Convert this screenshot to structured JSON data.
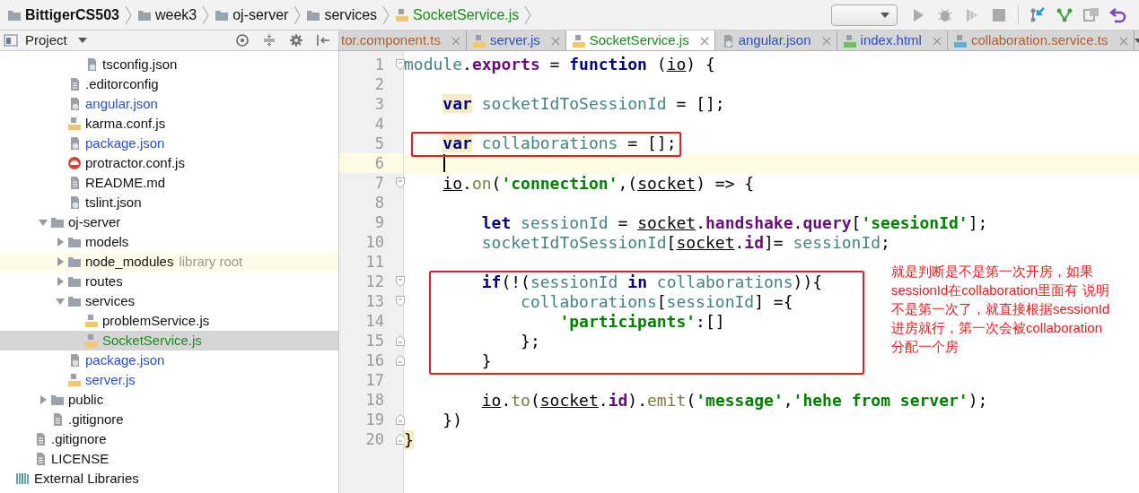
{
  "breadcrumb": [
    {
      "label": "BittigerCS503",
      "kind": "folder",
      "bold": true
    },
    {
      "label": "week3",
      "kind": "folder"
    },
    {
      "label": "oj-server",
      "kind": "folder"
    },
    {
      "label": "services",
      "kind": "folder"
    },
    {
      "label": "SocketService.js",
      "kind": "js",
      "color": "#1d8a1d"
    }
  ],
  "toolbar": {
    "buttons": [
      {
        "kind": "dropdown"
      },
      {
        "kind": "run"
      },
      {
        "kind": "debug"
      },
      {
        "kind": "coverage"
      },
      {
        "kind": "stop"
      },
      {
        "kind": "vcs-update"
      },
      {
        "kind": "vcs-commit"
      },
      {
        "kind": "compare"
      },
      {
        "kind": "revert"
      }
    ]
  },
  "project_panel": {
    "title": "Project",
    "tree": [
      {
        "children": [
          {
            "children": [
              {
                "children": [
                  {
                    "children": [
                      {
                        "label": "tsconfig.json",
                        "kind": "json"
                      }
                    ]
                  },
                  {
                    "label": ".editorconfig",
                    "kind": "text"
                  },
                  {
                    "label": "angular.json",
                    "kind": "json",
                    "color": "#2d4fbd"
                  },
                  {
                    "label": "karma.conf.js",
                    "kind": "js"
                  },
                  {
                    "label": "package.json",
                    "kind": "json",
                    "color": "#2d4fbd"
                  },
                  {
                    "label": "protractor.conf.js",
                    "kind": "protractor"
                  },
                  {
                    "label": "README.md",
                    "kind": "text"
                  },
                  {
                    "label": "tslint.json",
                    "kind": "json"
                  }
                ]
              },
              {
                "label": "oj-server",
                "kind": "folder",
                "expanded": true,
                "children": [
                  {
                    "label": "models",
                    "kind": "folder",
                    "expanded": false
                  },
                  {
                    "label": "node_modules",
                    "kind": "folder",
                    "expanded": false,
                    "library_root": true,
                    "note": "library root"
                  },
                  {
                    "label": "routes",
                    "kind": "folder",
                    "expanded": false
                  },
                  {
                    "label": "services",
                    "kind": "folder",
                    "expanded": true,
                    "children": [
                      {
                        "label": "problemService.js",
                        "kind": "js",
                        "selected": false
                      },
                      {
                        "label": "SocketService.js",
                        "kind": "js",
                        "color": "#1d8a1d",
                        "selected": true
                      }
                    ]
                  },
                  {
                    "label": "package.json",
                    "kind": "json",
                    "color": "#2d4fbd"
                  },
                  {
                    "label": "server.js",
                    "kind": "js",
                    "color": "#2d4fbd"
                  }
                ]
              },
              {
                "label": "public",
                "kind": "folder",
                "expanded": false
              },
              {
                "label": ".gitignore",
                "kind": "text"
              }
            ]
          },
          {
            "label": ".gitignore",
            "kind": "text"
          },
          {
            "label": "LICENSE",
            "kind": "text"
          }
        ]
      },
      {
        "label": "External Libraries",
        "kind": "libraries"
      }
    ]
  },
  "editor": {
    "tabs": [
      {
        "label": "tor.component.ts",
        "color": "#b0602e",
        "selected": false
      },
      {
        "label": "server.js",
        "kind": "js",
        "color": "#2d4fbd",
        "selected": false
      },
      {
        "label": "SocketService.js",
        "kind": "js",
        "color": "#1d8a1d",
        "selected": true
      },
      {
        "label": "angular.json",
        "kind": "json",
        "color": "#2d4fbd",
        "selected": false
      },
      {
        "label": "index.html",
        "kind": "html",
        "color": "#2d4fbd",
        "selected": false
      },
      {
        "label": "collaboration.service.ts",
        "kind": "ts",
        "color": "#b0602e",
        "selected": false
      }
    ],
    "lines": [
      {
        "number": "1",
        "fold_start": true,
        "tokens": [
          {
            "text": "module",
            "kind": "ident"
          },
          {
            "text": ".",
            "kind": "plain"
          },
          {
            "text": "exports",
            "kind": "prop"
          },
          {
            "text": " = ",
            "kind": "plain"
          },
          {
            "text": "function",
            "kind": "kw"
          },
          {
            "text": " (",
            "kind": "plain"
          },
          {
            "text": "io",
            "kind": "param"
          },
          {
            "text": ") {",
            "kind": "plain"
          }
        ]
      },
      {
        "number": "2"
      },
      {
        "number": "3",
        "tokens": [
          {
            "text": "    var",
            "kind": "kw-hl"
          },
          {
            "text": " socketIdToSessionId",
            "kind": "ident"
          },
          {
            "text": " = [];",
            "kind": "plain"
          }
        ]
      },
      {
        "number": "4"
      },
      {
        "number": "5",
        "boxed": true,
        "tokens": [
          {
            "text": "    var",
            "kind": "kw-hl"
          },
          {
            "text": " collaborations",
            "kind": "ident"
          },
          {
            "text": " = [];",
            "kind": "plain"
          }
        ]
      },
      {
        "number": "6",
        "current": true
      },
      {
        "number": "7",
        "fold_start": true,
        "tokens": [
          {
            "text": "    io",
            "kind": "param"
          },
          {
            "text": ".",
            "kind": "plain"
          },
          {
            "text": "on",
            "kind": "method"
          },
          {
            "text": "(",
            "kind": "plain"
          },
          {
            "text": "'connection'",
            "kind": "str"
          },
          {
            "text": ",(",
            "kind": "plain"
          },
          {
            "text": "socket",
            "kind": "param"
          },
          {
            "text": ") => {",
            "kind": "plain"
          }
        ]
      },
      {
        "number": "8"
      },
      {
        "number": "9",
        "tokens": [
          {
            "text": "        let",
            "kind": "kw"
          },
          {
            "text": " sessionId",
            "kind": "ident"
          },
          {
            "text": " = ",
            "kind": "plain"
          },
          {
            "text": "socket",
            "kind": "param"
          },
          {
            "text": ".",
            "kind": "plain"
          },
          {
            "text": "handshake",
            "kind": "prop"
          },
          {
            "text": ".",
            "kind": "plain"
          },
          {
            "text": "query",
            "kind": "prop"
          },
          {
            "text": "[",
            "kind": "plain"
          },
          {
            "text": "'seesionId'",
            "kind": "str"
          },
          {
            "text": "];",
            "kind": "plain"
          }
        ]
      },
      {
        "number": "10",
        "tokens": [
          {
            "text": "        socketIdToSessionId",
            "kind": "ident"
          },
          {
            "text": "[",
            "kind": "plain"
          },
          {
            "text": "socket",
            "kind": "param"
          },
          {
            "text": ".",
            "kind": "plain"
          },
          {
            "text": "id",
            "kind": "prop"
          },
          {
            "text": "]= ",
            "kind": "plain"
          },
          {
            "text": "sessionId",
            "kind": "ident"
          },
          {
            "text": ";",
            "kind": "plain"
          }
        ]
      },
      {
        "number": "11"
      },
      {
        "number": "12",
        "fold_start": true,
        "boxed": true,
        "tokens": [
          {
            "text": "        if",
            "kind": "kw"
          },
          {
            "text": "(!(",
            "kind": "plain"
          },
          {
            "text": "sessionId",
            "kind": "ident"
          },
          {
            "text": " in",
            "kind": "kw"
          },
          {
            "text": " collaborations",
            "kind": "ident"
          },
          {
            "text": ")){",
            "kind": "plain"
          }
        ]
      },
      {
        "number": "13",
        "fold_start": true,
        "boxed": true,
        "tokens": [
          {
            "text": "            collaborations",
            "kind": "ident"
          },
          {
            "text": "[",
            "kind": "plain"
          },
          {
            "text": "sessionId",
            "kind": "ident"
          },
          {
            "text": "] ={",
            "kind": "plain"
          }
        ]
      },
      {
        "number": "14",
        "boxed": true,
        "tokens": [
          {
            "text": "                'participants'",
            "kind": "str"
          },
          {
            "text": ":[]",
            "kind": "plain"
          }
        ]
      },
      {
        "number": "15",
        "fold_end": true,
        "boxed": true,
        "tokens": [
          {
            "text": "            };",
            "kind": "plain"
          }
        ]
      },
      {
        "number": "16",
        "fold_end": true,
        "boxed": true,
        "tokens": [
          {
            "text": "        }",
            "kind": "plain"
          }
        ]
      },
      {
        "number": "17"
      },
      {
        "number": "18",
        "tokens": [
          {
            "text": "        io",
            "kind": "param"
          },
          {
            "text": ".",
            "kind": "plain"
          },
          {
            "text": "to",
            "kind": "method"
          },
          {
            "text": "(",
            "kind": "plain"
          },
          {
            "text": "socket",
            "kind": "param"
          },
          {
            "text": ".",
            "kind": "plain"
          },
          {
            "text": "id",
            "kind": "prop"
          },
          {
            "text": ").",
            "kind": "plain"
          },
          {
            "text": "emit",
            "kind": "method"
          },
          {
            "text": "(",
            "kind": "plain"
          },
          {
            "text": "'message'",
            "kind": "str"
          },
          {
            "text": ",",
            "kind": "plain"
          },
          {
            "text": "'hehe from server'",
            "kind": "str"
          },
          {
            "text": ");",
            "kind": "plain"
          }
        ]
      },
      {
        "number": "19",
        "fold_end": true,
        "tokens": [
          {
            "text": "    })",
            "kind": "plain"
          }
        ]
      },
      {
        "number": "20",
        "fold_end": true,
        "tokens": [
          {
            "text": "}",
            "kind": "brace-hl"
          }
        ]
      }
    ],
    "note": "就是判断是不是第一次开房，如果sessionId在collaboration里面有 说明不是第一次了，就直接根据sessionId进房就行，第一次会被collaboration分配一个房"
  }
}
